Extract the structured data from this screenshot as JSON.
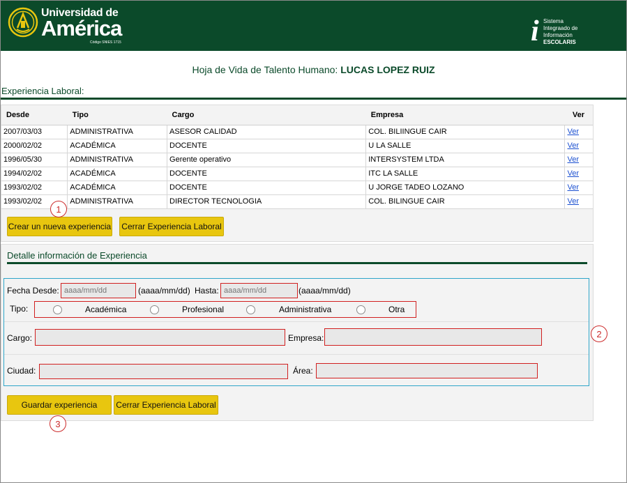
{
  "header": {
    "brand_top": "Universidad de",
    "brand_main": "América",
    "brand_code": "Código SNIES 1715",
    "system_i": "i",
    "system_lines": [
      "Sistema",
      "Integraado de",
      "Información"
    ],
    "system_name": "ESCOLARIS",
    "colors": {
      "header_bg": "#0b4a2a",
      "logo_gold": "#e8c60f"
    }
  },
  "page": {
    "title_prefix": "Hoja de Vida de Talento Humano: ",
    "person_name": "LUCAS LOPEZ RUIZ",
    "section_label": "Experiencia Laboral:"
  },
  "table": {
    "headers": {
      "desde": "Desde",
      "tipo": "Tipo",
      "cargo": "Cargo",
      "empresa": "Empresa",
      "ver": "Ver"
    },
    "rows": [
      {
        "desde": "2007/03/03",
        "tipo": "ADMINISTRATIVA",
        "cargo": "ASESOR CALIDAD",
        "empresa": "COL. BILIINGUE CAIR",
        "ver": "Ver"
      },
      {
        "desde": "2000/02/02",
        "tipo": "ACADÉMICA",
        "cargo": "DOCENTE",
        "empresa": "U LA SALLE",
        "ver": "Ver"
      },
      {
        "desde": "1996/05/30",
        "tipo": "ADMINISTRATIVA",
        "cargo": "Gerente operativo",
        "empresa": "INTERSYSTEM LTDA",
        "ver": "Ver"
      },
      {
        "desde": "1994/02/02",
        "tipo": "ACADÉMICA",
        "cargo": "DOCENTE",
        "empresa": "ITC LA SALLE",
        "ver": "Ver"
      },
      {
        "desde": "1993/02/02",
        "tipo": "ACADÉMICA",
        "cargo": "DOCENTE",
        "empresa": "U JORGE TADEO LOZANO",
        "ver": "Ver"
      },
      {
        "desde": "1993/02/02",
        "tipo": "ADMINISTRATIVA",
        "cargo": "DIRECTOR TECNOLOGIA",
        "empresa": "COL. BILINGUE CAIR",
        "ver": "Ver"
      }
    ]
  },
  "buttons": {
    "crear": "Crear un nueva experiencia",
    "cerrar_top": "Cerrar Experiencia Laboral",
    "guardar": "Guardar experiencia",
    "cerrar_bottom": "Cerrar Experiencia Laboral"
  },
  "markers": {
    "m1": "1",
    "m2": "2",
    "m3": "3"
  },
  "detail": {
    "title": "Detalle información de Experiencia",
    "fecha_desde_label": "Fecha Desde:",
    "fecha_desde_placeholder": "aaaa/mm/dd",
    "fecha_desde_hint": "(aaaa/mm/dd)",
    "hasta_label": "Hasta:",
    "hasta_placeholder": "aaaa/mm/dd",
    "hasta_hint": "(aaaa/mm/dd)",
    "tipo_label": "Tipo:",
    "tipo_options": [
      "Académica",
      "Profesional",
      "Administrativa",
      "Otra"
    ],
    "cargo_label": "Cargo:",
    "cargo_value": "",
    "empresa_label": "Empresa:",
    "empresa_value": "",
    "ciudad_label": "Ciudad:",
    "ciudad_value": "",
    "area_label": "Área:",
    "area_value": ""
  }
}
